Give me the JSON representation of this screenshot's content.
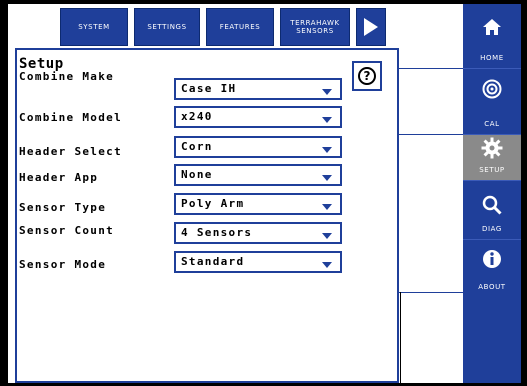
{
  "tabs": [
    {
      "label": "SYSTEM"
    },
    {
      "label": "SETTINGS"
    },
    {
      "label": "FEATURES"
    },
    {
      "label": "TERRAHAWK SENSORS"
    }
  ],
  "panel": {
    "title": "Setup",
    "rows": [
      {
        "label": "Combine Make",
        "value": "Case IH"
      },
      {
        "label": "Combine Model",
        "value": "x240"
      },
      {
        "label": "Header Select",
        "value": "Corn"
      },
      {
        "label": "Header App",
        "value": "None"
      },
      {
        "label": "Sensor Type",
        "value": "Poly Arm"
      },
      {
        "label": "Sensor Count",
        "value": "4 Sensors"
      },
      {
        "label": "Sensor Mode",
        "value": "Standard"
      }
    ],
    "help_symbol": "?"
  },
  "sidebar": {
    "items": [
      {
        "label": "HOME",
        "icon": "home-icon",
        "active": false
      },
      {
        "label": "CAL",
        "icon": "target-icon",
        "active": false
      },
      {
        "label": "SETUP",
        "icon": "gear-icon",
        "active": true
      },
      {
        "label": "DIAG",
        "icon": "magnifier-icon",
        "active": false
      },
      {
        "label": "ABOUT",
        "icon": "info-icon",
        "active": false
      }
    ]
  },
  "colors": {
    "accent": "#1f3f9a",
    "active": "#8a8a8a",
    "frame": "#000000"
  }
}
